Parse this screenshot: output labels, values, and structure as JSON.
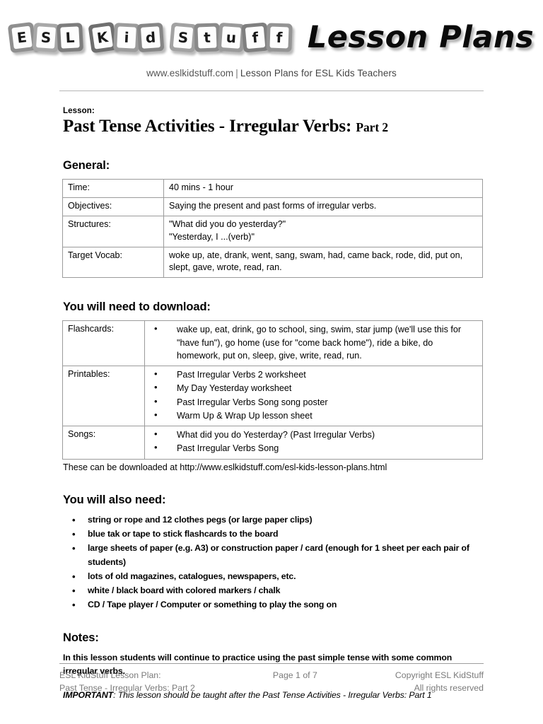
{
  "header": {
    "logo_tiles": [
      {
        "char": "E",
        "tone": "#8f8f8f",
        "rot": -7
      },
      {
        "char": "S",
        "tone": "#a8a8a8",
        "rot": 4
      },
      {
        "char": "L",
        "tone": "#7d7d7d",
        "rot": -3
      },
      {
        "char": "K",
        "tone": "#6f6f6f",
        "rot": -8
      },
      {
        "char": "i",
        "tone": "#9c9c9c",
        "rot": 3
      },
      {
        "char": "d",
        "tone": "#868686",
        "rot": -4
      },
      {
        "char": "S",
        "tone": "#a2a2a2",
        "rot": 5
      },
      {
        "char": "t",
        "tone": "#8a8a8a",
        "rot": -2
      },
      {
        "char": "u",
        "tone": "#9a9a9a",
        "rot": 4
      },
      {
        "char": "f",
        "tone": "#7f7f7f",
        "rot": -5
      },
      {
        "char": "f",
        "tone": "#949494",
        "rot": 2
      }
    ],
    "logo_text": "ESL Kid Stuff",
    "script_title": "Lesson Plans",
    "tagline_site": "www.eslkidstuff.com",
    "tagline_separator": "|",
    "tagline_text": "Lesson Plans for ESL Kids Teachers"
  },
  "lesson": {
    "label": "Lesson:",
    "title": "Past Tense Activities - Irregular Verbs:",
    "part": "Part 2"
  },
  "sections": {
    "general_heading": "General:",
    "download_heading": "You will need to download:",
    "also_need_heading": "You will also need:",
    "notes_heading": "Notes:"
  },
  "general_table": {
    "rows": [
      {
        "label": "Time:",
        "lines": [
          "40 mins - 1 hour"
        ]
      },
      {
        "label": "Objectives:",
        "lines": [
          "Saying the present and past forms of irregular verbs."
        ]
      },
      {
        "label": "Structures:",
        "lines": [
          "\"What did you do yesterday?\"",
          "\"Yesterday, I ...(verb)\""
        ]
      },
      {
        "label": "Target Vocab:",
        "lines": [
          "woke up, ate, drank, went, sang, swam, had, came back, rode, did, put on, slept, gave, wrote, read, ran."
        ]
      }
    ]
  },
  "download_table": {
    "rows": [
      {
        "label": "Flashcards:",
        "items": [
          "wake up, eat, drink, go to school, sing, swim, star jump (we'll use this for \"have fun\"), go home (use for \"come back home\"), ride a bike, do homework, put on, sleep, give, write, read, run."
        ]
      },
      {
        "label": "Printables:",
        "items": [
          "Past Irregular Verbs 2 worksheet",
          "My Day Yesterday worksheet",
          "Past Irregular Verbs Song song poster",
          "Warm Up & Wrap Up lesson sheet"
        ]
      },
      {
        "label": "Songs:",
        "items": [
          "What did you do Yesterday? (Past Irregular Verbs)",
          "Past Irregular Verbs Song"
        ]
      }
    ],
    "download_note": "These can be downloaded at http://www.eslkidstuff.com/esl-kids-lesson-plans.html"
  },
  "also_need_items": [
    "string or rope and 12 clothes pegs (or large paper clips)",
    "blue tak or tape to stick flashcards to the board",
    "large sheets of paper (e.g. A3) or construction paper / card (enough for 1 sheet per each pair of students)",
    "lots of old magazines, catalogues, newspapers, etc.",
    "white / black board with colored markers / chalk",
    "CD / Tape player / Computer or something to play the song on"
  ],
  "notes": {
    "body": "In this lesson students will continue to practice using the past simple tense with some common irregular verbs.",
    "important_keyword": "IMPORTANT",
    "important_text": ": This lesson should be taught after the Past Tense Activities - Irregular Verbs: Part 1"
  },
  "footer": {
    "left_line1": "ESL KidStuff Lesson Plan:",
    "left_line2": "Past Tense - Irregular Verbs: Part 2",
    "center": "Page 1 of 7",
    "right_line1": "Copyright ESL KidStuff",
    "right_line2": "All rights reserved"
  }
}
